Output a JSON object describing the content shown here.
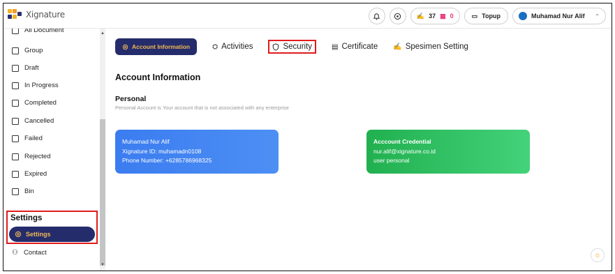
{
  "app": {
    "logo_text": "Xignature"
  },
  "header": {
    "quota_signature": "37",
    "quota_qr": "0",
    "topup_label": "Topup",
    "user_name": "Muhamad Nur Alif"
  },
  "sidebar": {
    "cut_label": "All Document",
    "items": [
      {
        "label": "Group"
      },
      {
        "label": "Draft"
      },
      {
        "label": "In Progress"
      },
      {
        "label": "Completed"
      },
      {
        "label": "Cancelled"
      },
      {
        "label": "Failed"
      },
      {
        "label": "Rejected"
      },
      {
        "label": "Expired"
      },
      {
        "label": "Bin"
      }
    ],
    "settings_section": "Settings",
    "settings_item": "Settings",
    "contact": "Contact"
  },
  "tabs": [
    {
      "label": "Account Information"
    },
    {
      "label": "Activities"
    },
    {
      "label": "Security"
    },
    {
      "label": "Certificate"
    },
    {
      "label": "Spesimen Setting"
    }
  ],
  "main": {
    "title": "Account Information",
    "section": "Personal",
    "section_desc": "Personal Account is Your account that is not associated with any enterprise"
  },
  "cards": {
    "personal": {
      "name": "Muhamad Nur Alif",
      "xid": "Xignature ID: muhamadn0108",
      "phone": "Phone Number: +6285786968325"
    },
    "credential": {
      "title": "Acccount Credential",
      "email": "nur.alif@xignature.co.id",
      "type": "user personal"
    }
  }
}
